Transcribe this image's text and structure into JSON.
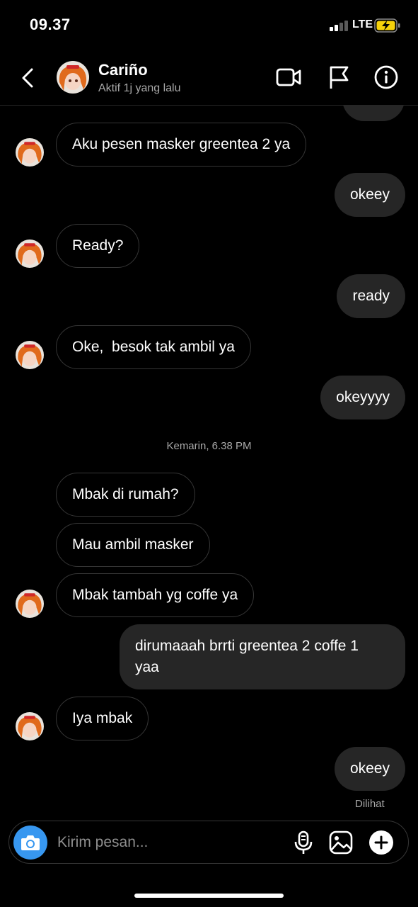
{
  "status_bar": {
    "time": "09.37",
    "network": "LTE",
    "battery_icon": "battery-charging-icon",
    "signal_icon": "signal-bars-icon"
  },
  "header": {
    "name": "Cariño",
    "status": "Aktif 1j yang lalu",
    "icons": [
      "chevron-left-icon",
      "video-call-icon",
      "flag-icon",
      "info-icon"
    ]
  },
  "messages": {
    "m1": "Aku pesen masker greentea 2 ya",
    "m2": "okeey",
    "m3": "Ready?",
    "m4": "ready",
    "m5": "Oke,  besok tak ambil ya",
    "m6": "okeyyyy",
    "divider": "Kemarin, 6.38 PM",
    "m7": "Mbak di rumah?",
    "m8": "Mau ambil masker",
    "m9": "Mbak tambah yg coffe ya",
    "m10_line1": "dirumaaah brrti greentea 2 coffe 1",
    "m10_line2": "yaa",
    "m11": "Iya mbak",
    "m12": "okeey",
    "seen": "Dilihat"
  },
  "composer": {
    "placeholder": "Kirim pesan...",
    "icons": [
      "camera-icon",
      "microphone-icon",
      "gallery-icon",
      "plus-icon"
    ]
  },
  "colors": {
    "accent": "#3797f0",
    "outgoing_bubble": "#262626",
    "background": "#000000",
    "muted_text": "#a8a8a8"
  }
}
